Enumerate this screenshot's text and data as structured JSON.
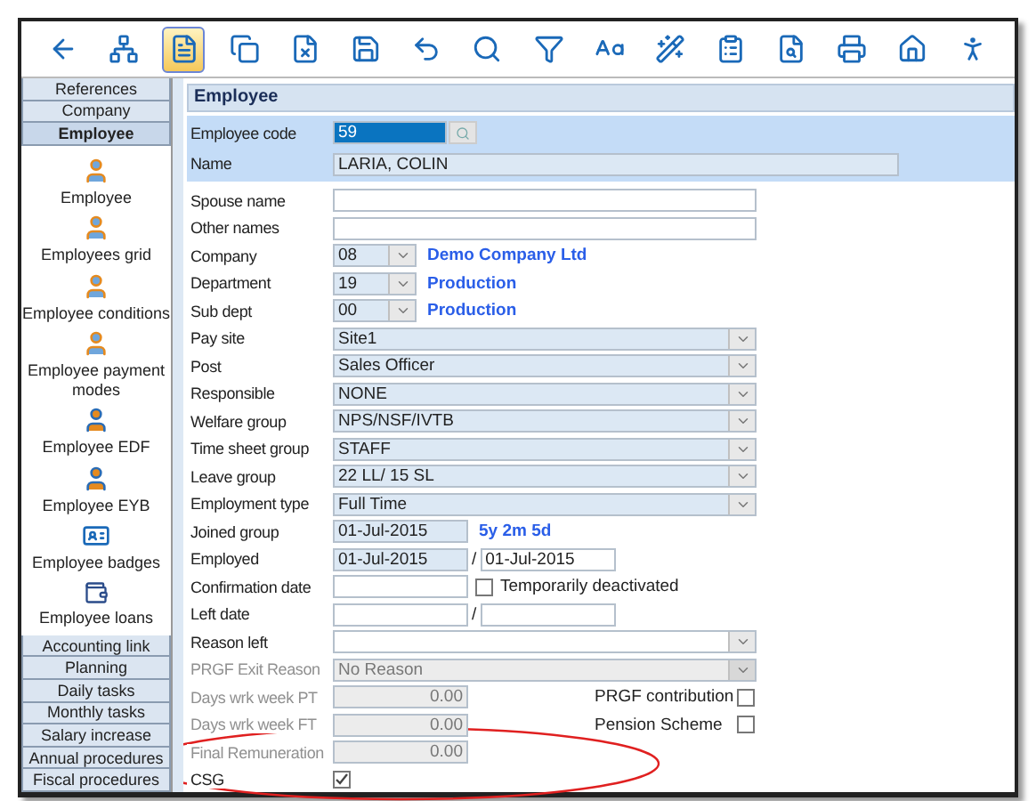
{
  "toolbar": {
    "buttons": [
      {
        "selected": false
      },
      {
        "selected": false
      },
      {
        "selected": true
      },
      {
        "selected": false
      },
      {
        "selected": false
      },
      {
        "selected": false
      },
      {
        "selected": false
      },
      {
        "selected": false
      },
      {
        "selected": false
      },
      {
        "selected": false
      },
      {
        "selected": false
      },
      {
        "selected": false
      },
      {
        "selected": false
      },
      {
        "selected": false
      },
      {
        "selected": false
      },
      {
        "selected": false
      }
    ]
  },
  "sidebar": {
    "top_tabs": [
      {
        "label": "References",
        "selected": false
      },
      {
        "label": "Company",
        "selected": false
      },
      {
        "label": "Employee",
        "selected": true
      }
    ],
    "items": [
      {
        "label": "Employee",
        "kind": "person"
      },
      {
        "label": "Employees grid",
        "kind": "person"
      },
      {
        "label": "Employee conditions",
        "kind": "person"
      },
      {
        "label": "Employee payment modes",
        "kind": "person"
      },
      {
        "label": "Employee EDF",
        "kind": "person_doc"
      },
      {
        "label": "Employee EYB",
        "kind": "person_doc"
      },
      {
        "label": "Employee badges",
        "kind": "badge"
      },
      {
        "label": "Employee loans",
        "kind": "loan"
      }
    ],
    "bottom_tabs": [
      {
        "label": "Accounting link",
        "selected": false
      },
      {
        "label": "Planning",
        "selected": false
      },
      {
        "label": "Daily tasks",
        "selected": false
      },
      {
        "label": "Monthly tasks",
        "selected": false
      },
      {
        "label": "Salary increase",
        "selected": false
      },
      {
        "label": "Annual procedures",
        "selected": false
      },
      {
        "label": "Fiscal procedures",
        "selected": false
      }
    ]
  },
  "form": {
    "title": "Employee",
    "header": {
      "code_label": "Employee code",
      "code": "59",
      "name_label": "Name",
      "name": "LARIA, COLIN"
    },
    "rows": [
      {
        "label": "Spouse name",
        "kind": "text",
        "disabled": false
      },
      {
        "label": "Other names",
        "kind": "text",
        "disabled": false
      },
      {
        "label": "Company",
        "kind": "code",
        "value": "08",
        "caption": "Demo Company Ltd",
        "disabled": false
      },
      {
        "label": "Department",
        "kind": "code",
        "value": "19",
        "caption": "Production",
        "disabled": false
      },
      {
        "label": "Sub dept",
        "kind": "code",
        "value": "00",
        "caption": "Production",
        "disabled": false
      },
      {
        "label": "Pay site",
        "kind": "select",
        "value": "Site1",
        "disabled": false
      },
      {
        "label": "Post",
        "kind": "select",
        "value": "Sales Officer",
        "disabled": false
      },
      {
        "label": "Responsible",
        "kind": "select",
        "value": "NONE",
        "disabled": false
      },
      {
        "label": "Welfare group",
        "kind": "select",
        "value": "NPS/NSF/IVTB",
        "disabled": false
      },
      {
        "label": "Time sheet group",
        "kind": "select",
        "value": "STAFF",
        "disabled": false
      },
      {
        "label": "Leave group",
        "kind": "select",
        "value": "22 LL/ 15 SL",
        "disabled": false
      },
      {
        "label": "Employment type",
        "kind": "select",
        "value": "Full Time",
        "disabled": false
      },
      {
        "label": "Joined group",
        "kind": "date",
        "value": "01-Jul-2015",
        "info": "5y 2m 5d",
        "disabled": false
      },
      {
        "label": "Employed",
        "kind": "date_range",
        "value": "01-Jul-2015",
        "separator": "/",
        "second": "01-Jul-2015",
        "disabled": false
      },
      {
        "label": "Confirmation date",
        "kind": "date_check",
        "check_label": "Temporarily deactivated",
        "checked": false,
        "disabled": false
      },
      {
        "label": "Left date",
        "kind": "date_range",
        "separator": "/",
        "disabled": false
      },
      {
        "label": "Reason left",
        "kind": "select",
        "disabled": false
      },
      {
        "label": "PRGF Exit Reason",
        "kind": "select",
        "value": "No Reason",
        "disabled": true
      },
      {
        "label": "Days wrk week PT",
        "kind": "number",
        "value": "0.00",
        "disabled": true,
        "side": {
          "label": "PRGF contribution",
          "checked": false
        }
      },
      {
        "label": "Days wrk week FT",
        "kind": "number",
        "value": "0.00",
        "disabled": true,
        "side": {
          "label": "Pension Scheme",
          "checked": false
        }
      },
      {
        "label": "Final Remuneration",
        "kind": "number",
        "value": "0.00",
        "disabled": true
      },
      {
        "label": "CSG",
        "kind": "check",
        "checked": true,
        "disabled": false
      }
    ]
  }
}
